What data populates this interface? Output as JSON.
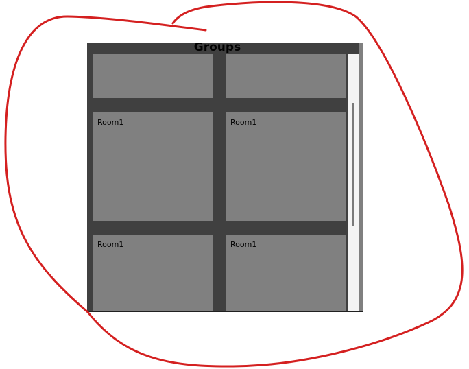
{
  "panel": {
    "title": "Groups"
  },
  "tiles": [
    {
      "label": ""
    },
    {
      "label": ""
    },
    {
      "label": "Room1"
    },
    {
      "label": "Room1"
    },
    {
      "label": "Room1"
    },
    {
      "label": "Room1"
    }
  ],
  "colors": {
    "panel_background": "#404040",
    "tile_background": "#808080",
    "scrollbar_track": "#f4f4f4",
    "annotation_stroke": "#d42020"
  }
}
